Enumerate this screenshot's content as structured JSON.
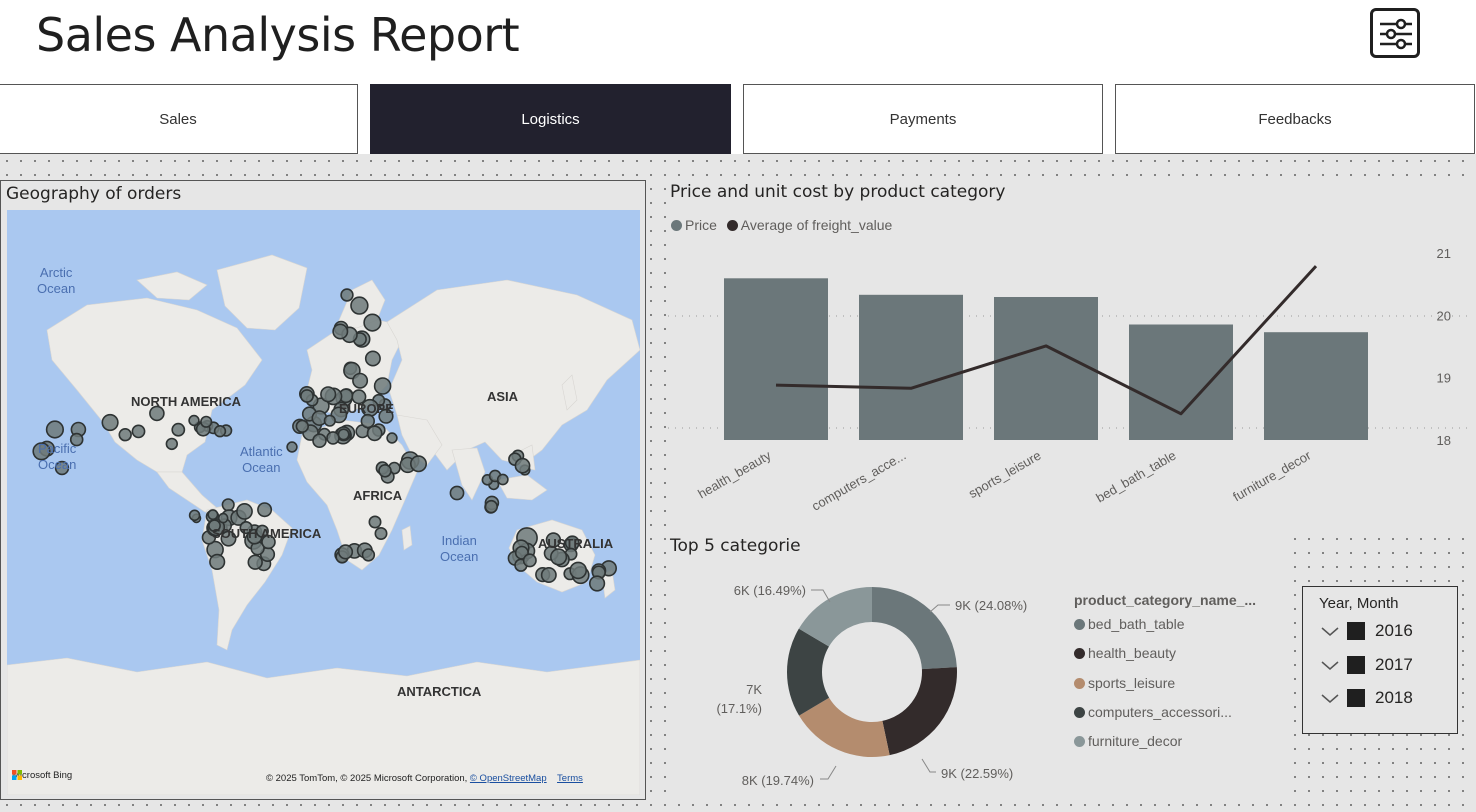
{
  "header": {
    "title": "Sales Analysis Report",
    "filter_icon": "sliders-icon"
  },
  "tabs": [
    {
      "label": "Sales",
      "active": false
    },
    {
      "label": "Logistics",
      "active": true
    },
    {
      "label": "Payments",
      "active": false
    },
    {
      "label": "Feedbacks",
      "active": false
    }
  ],
  "map": {
    "title": "Geography of orders",
    "oceans": {
      "arctic": "Arctic\nOcean",
      "pacific": "Pacific\nOcean",
      "atlantic": "Atlantic\nOcean",
      "indian": "Indian\nOcean"
    },
    "continents": {
      "north_america": "NORTH AMERICA",
      "south_america": "SOUTH AMERICA",
      "europe": "EUROPE",
      "asia": "ASIA",
      "africa": "AFRICA",
      "australia": "AUSTRALIA",
      "antarctica": "ANTARCTICA"
    },
    "attribution_logo": "Microsoft Bing",
    "copyright": "© 2025 TomTom, © 2025 Microsoft Corporation,",
    "osm_link": "© OpenStreetMap",
    "terms_link": "Terms"
  },
  "combo_chart": {
    "title": "Price and unit cost by product category",
    "legend": [
      {
        "label": "Price",
        "color": "#6b777a"
      },
      {
        "label": "Average of freight_value",
        "color": "#332b2b"
      }
    ]
  },
  "donut": {
    "title": "Top 5 categorie",
    "legend_title": "product_category_name_...",
    "legend": [
      {
        "label": "bed_bath_table",
        "color": "#6b777a"
      },
      {
        "label": "health_beauty",
        "color": "#332b2b"
      },
      {
        "label": "sports_leisure",
        "color": "#b48c6e"
      },
      {
        "label": "computers_accessori...",
        "color": "#3d4444"
      },
      {
        "label": "furniture_decor",
        "color": "#8a9799"
      }
    ],
    "labels": {
      "bed_bath_table": "9K (24.08%)",
      "health_beauty": "9K (22.59%)",
      "sports_leisure": "8K (19.74%)",
      "computers_line1": "7K",
      "computers_line2": "(17.1%)",
      "furniture_decor": "6K (16.49%)"
    }
  },
  "slicer": {
    "title": "Year, Month",
    "years": [
      "2016",
      "2017",
      "2018"
    ]
  },
  "chart_data": [
    {
      "type": "bar",
      "title": "Price and unit cost by product category",
      "categories": [
        "health_beauty",
        "computers_acce...",
        "sports_leisure",
        "bed_bath_table",
        "furniture_decor"
      ],
      "series": [
        {
          "name": "Price",
          "type": "bar",
          "values": [
            1.47,
            1.32,
            1.3,
            1.05,
            0.98
          ]
        },
        {
          "name": "Average of freight_value",
          "type": "line",
          "axis": "right",
          "values": [
            18.88,
            18.83,
            19.51,
            18.42,
            20.79
          ]
        }
      ],
      "y2_ticks": [
        "18",
        "19",
        "20",
        "21"
      ],
      "y2lim": [
        18,
        21
      ],
      "grid": true,
      "legend": "top-left"
    },
    {
      "type": "pie",
      "title": "Top 5 categorie",
      "categories": [
        "bed_bath_table",
        "health_beauty",
        "sports_leisure",
        "computers_accessories",
        "furniture_decor"
      ],
      "values": [
        24.08,
        22.59,
        19.74,
        17.1,
        16.49
      ],
      "value_labels": [
        "9K",
        "9K",
        "8K",
        "7K",
        "6K"
      ],
      "donut": true,
      "legend": "right"
    }
  ]
}
